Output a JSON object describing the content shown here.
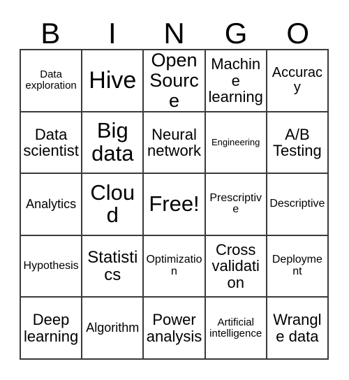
{
  "card": {
    "title": "BINGO",
    "header_letters": [
      "B",
      "I",
      "N",
      "G",
      "O"
    ],
    "free_space_label": "Free!",
    "colors": {
      "background": "#ffffff",
      "text": "#000000",
      "grid_line": "#3a3a3a"
    },
    "grid_size": "5x5",
    "rows": [
      [
        {
          "label": "Data exploration",
          "size": "sz-s",
          "free": false
        },
        {
          "label": "Hive",
          "size": "sz-4xl",
          "free": false
        },
        {
          "label": "Open Source",
          "size": "sz-2xl",
          "free": false
        },
        {
          "label": "Machine learning",
          "size": "sz-l",
          "free": false
        },
        {
          "label": "Accuracy",
          "size": "sz-ml",
          "free": false
        }
      ],
      [
        {
          "label": "Data scientist",
          "size": "sz-l",
          "free": false
        },
        {
          "label": "Big data",
          "size": "sz-3xl",
          "free": false
        },
        {
          "label": "Neural network",
          "size": "sz-l",
          "free": false
        },
        {
          "label": "Engineering",
          "size": "sz-xs",
          "free": false
        },
        {
          "label": "A/B Testing",
          "size": "sz-l",
          "free": false
        }
      ],
      [
        {
          "label": "Analytics",
          "size": "sz-m",
          "free": false
        },
        {
          "label": "Cloud",
          "size": "sz-3xl",
          "free": false
        },
        {
          "label": "Free!",
          "size": "sz-3xl",
          "free": true
        },
        {
          "label": "Prescriptive",
          "size": "sz-sm",
          "free": false
        },
        {
          "label": "Descriptive",
          "size": "sz-sm",
          "free": false
        }
      ],
      [
        {
          "label": "Hypothesis",
          "size": "sz-sm",
          "free": false
        },
        {
          "label": "Statistics",
          "size": "sz-xl",
          "free": false
        },
        {
          "label": "Optimization",
          "size": "sz-sm",
          "free": false
        },
        {
          "label": "Cross validation",
          "size": "sz-l",
          "free": false
        },
        {
          "label": "Deployment",
          "size": "sz-sm",
          "free": false
        }
      ],
      [
        {
          "label": "Deep learning",
          "size": "sz-l",
          "free": false
        },
        {
          "label": "Algorithm",
          "size": "sz-m",
          "free": false
        },
        {
          "label": "Power analysis",
          "size": "sz-l",
          "free": false
        },
        {
          "label": "Artificial intelligence",
          "size": "sz-s",
          "free": false
        },
        {
          "label": "Wrangle data",
          "size": "sz-l",
          "free": false
        }
      ]
    ]
  }
}
